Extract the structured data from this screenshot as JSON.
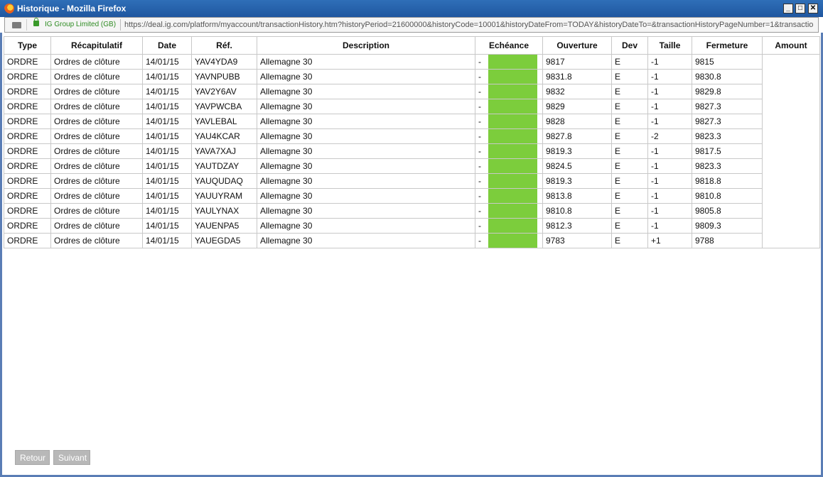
{
  "window": {
    "title": "Historique - Mozilla Firefox",
    "minimize": "_",
    "maximize": "□",
    "close": "✕"
  },
  "urlbar": {
    "identity": "IG Group Limited (GB)",
    "url": "https://deal.ig.com/platform/myaccount/transactionHistory.htm?historyPeriod=21600000&historyCode=10001&historyDateFrom=TODAY&historyDateTo=&transactionHistoryPageNumber=1&transactio"
  },
  "table": {
    "headers": [
      "Type",
      "Récapitulatif",
      "Date",
      "Réf.",
      "Description",
      "Echéance",
      "Ouverture",
      "Dev",
      "Taille",
      "Fermeture",
      "Amount"
    ],
    "rows": [
      {
        "type": "ORDRE",
        "recap": "Ordres de clôture",
        "date": "14/01/15",
        "ref": "YAV4YDA9",
        "desc": "Allemagne 30",
        "ech": "-",
        "ouv": "9817",
        "dev": "E",
        "taille": "-1",
        "ferm": "9815"
      },
      {
        "type": "ORDRE",
        "recap": "Ordres de clôture",
        "date": "14/01/15",
        "ref": "YAVNPUBB",
        "desc": "Allemagne 30",
        "ech": "-",
        "ouv": "9831.8",
        "dev": "E",
        "taille": "-1",
        "ferm": "9830.8"
      },
      {
        "type": "ORDRE",
        "recap": "Ordres de clôture",
        "date": "14/01/15",
        "ref": "YAV2Y6AV",
        "desc": "Allemagne 30",
        "ech": "-",
        "ouv": "9832",
        "dev": "E",
        "taille": "-1",
        "ferm": "9829.8"
      },
      {
        "type": "ORDRE",
        "recap": "Ordres de clôture",
        "date": "14/01/15",
        "ref": "YAVPWCBA",
        "desc": "Allemagne 30",
        "ech": "-",
        "ouv": "9829",
        "dev": "E",
        "taille": "-1",
        "ferm": "9827.3"
      },
      {
        "type": "ORDRE",
        "recap": "Ordres de clôture",
        "date": "14/01/15",
        "ref": "YAVLEBAL",
        "desc": "Allemagne 30",
        "ech": "-",
        "ouv": "9828",
        "dev": "E",
        "taille": "-1",
        "ferm": "9827.3"
      },
      {
        "type": "ORDRE",
        "recap": "Ordres de clôture",
        "date": "14/01/15",
        "ref": "YAU4KCAR",
        "desc": "Allemagne 30",
        "ech": "-",
        "ouv": "9827.8",
        "dev": "E",
        "taille": "-2",
        "ferm": "9823.3"
      },
      {
        "type": "ORDRE",
        "recap": "Ordres de clôture",
        "date": "14/01/15",
        "ref": "YAVA7XAJ",
        "desc": "Allemagne 30",
        "ech": "-",
        "ouv": "9819.3",
        "dev": "E",
        "taille": "-1",
        "ferm": "9817.5"
      },
      {
        "type": "ORDRE",
        "recap": "Ordres de clôture",
        "date": "14/01/15",
        "ref": "YAUTDZAY",
        "desc": "Allemagne 30",
        "ech": "-",
        "ouv": "9824.5",
        "dev": "E",
        "taille": "-1",
        "ferm": "9823.3"
      },
      {
        "type": "ORDRE",
        "recap": "Ordres de clôture",
        "date": "14/01/15",
        "ref": "YAUQUDAQ",
        "desc": "Allemagne 30",
        "ech": "-",
        "ouv": "9819.3",
        "dev": "E",
        "taille": "-1",
        "ferm": "9818.8"
      },
      {
        "type": "ORDRE",
        "recap": "Ordres de clôture",
        "date": "14/01/15",
        "ref": "YAUUYRAM",
        "desc": "Allemagne 30",
        "ech": "-",
        "ouv": "9813.8",
        "dev": "E",
        "taille": "-1",
        "ferm": "9810.8"
      },
      {
        "type": "ORDRE",
        "recap": "Ordres de clôture",
        "date": "14/01/15",
        "ref": "YAULYNAX",
        "desc": "Allemagne 30",
        "ech": "-",
        "ouv": "9810.8",
        "dev": "E",
        "taille": "-1",
        "ferm": "9805.8"
      },
      {
        "type": "ORDRE",
        "recap": "Ordres de clôture",
        "date": "14/01/15",
        "ref": "YAUENPA5",
        "desc": "Allemagne 30",
        "ech": "-",
        "ouv": "9812.3",
        "dev": "E",
        "taille": "-1",
        "ferm": "9809.3"
      },
      {
        "type": "ORDRE",
        "recap": "Ordres de clôture",
        "date": "14/01/15",
        "ref": "YAUEGDA5",
        "desc": "Allemagne 30",
        "ech": "-",
        "ouv": "9783",
        "dev": "E",
        "taille": "+1",
        "ferm": "9788"
      }
    ]
  },
  "colors": {
    "echeance_fill": "#7ccd3c",
    "title_bar": "#2f6fb8",
    "button_bg": "#b8b8b8"
  },
  "nav": {
    "back": "Retour",
    "next": "Suivant"
  }
}
